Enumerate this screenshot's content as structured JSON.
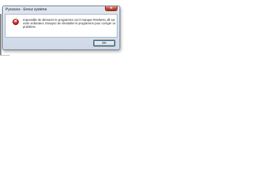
{
  "dialog": {
    "title": "Pyxxsoxx - Erreur système",
    "close_label": "✕",
    "error_icon_glyph": "✕",
    "message": "Impossible de démarrer le programme car il manque RSSMAIL.dll sur votre ordinateur. Essayez de réinstaller le programme pour corriger ce problème.",
    "ok_label": "OK",
    "colors": {
      "close_button": "#c2412d",
      "error_icon": "#c8231a",
      "frame": "#dfe7f1"
    },
    "icons": {
      "error": "error-icon",
      "close": "close-icon"
    }
  }
}
